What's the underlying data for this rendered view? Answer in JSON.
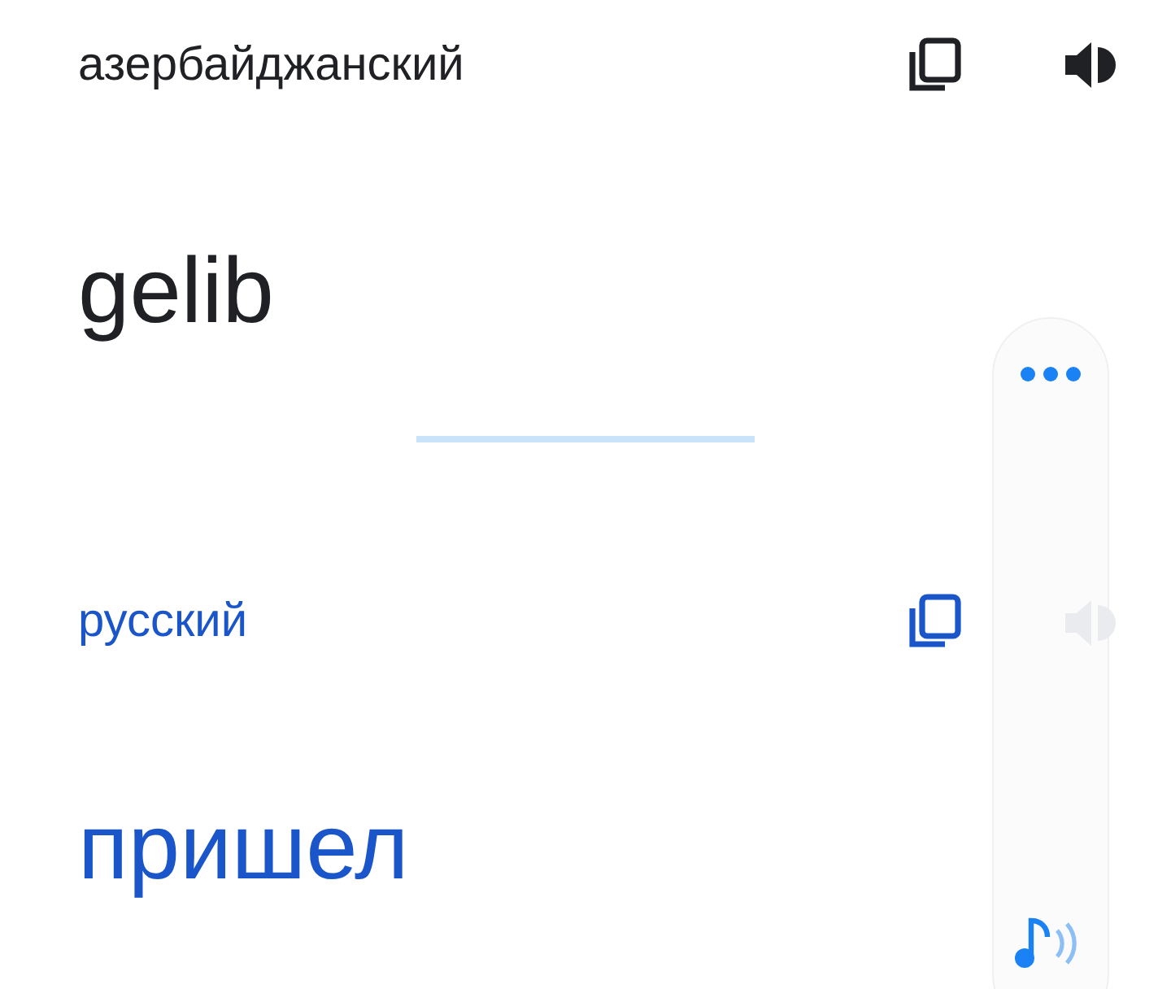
{
  "source": {
    "language": "азербайджанский",
    "text": "gelib"
  },
  "target": {
    "language": "русский",
    "text": "пришел"
  }
}
